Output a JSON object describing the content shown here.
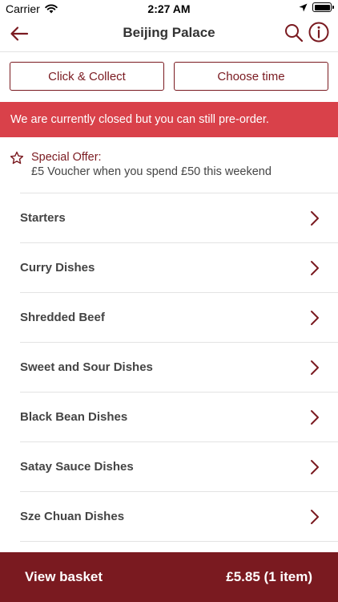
{
  "status_bar": {
    "carrier": "Carrier",
    "time": "2:27 AM"
  },
  "nav": {
    "title": "Beijing Palace",
    "back_icon": "arrow-left-icon",
    "search_icon": "search-icon",
    "info_icon": "info-icon"
  },
  "order_mode": {
    "collect_label": "Click & Collect",
    "time_label": "Choose time"
  },
  "notice": {
    "closed_text": "We are currently closed but you can still pre-order."
  },
  "offer": {
    "icon": "star-icon",
    "title": "Special Offer:",
    "text": "£5 Voucher when you spend £50 this weekend"
  },
  "categories": [
    {
      "label": "Starters"
    },
    {
      "label": "Curry Dishes"
    },
    {
      "label": "Shredded Beef"
    },
    {
      "label": "Sweet and Sour Dishes"
    },
    {
      "label": "Black Bean Dishes"
    },
    {
      "label": "Satay Sauce Dishes"
    },
    {
      "label": "Sze Chuan Dishes"
    }
  ],
  "basket": {
    "label": "View basket",
    "total": "£5.85 (1 item)"
  },
  "colors": {
    "brand": "#7a1a20",
    "banner": "#d9414a"
  }
}
